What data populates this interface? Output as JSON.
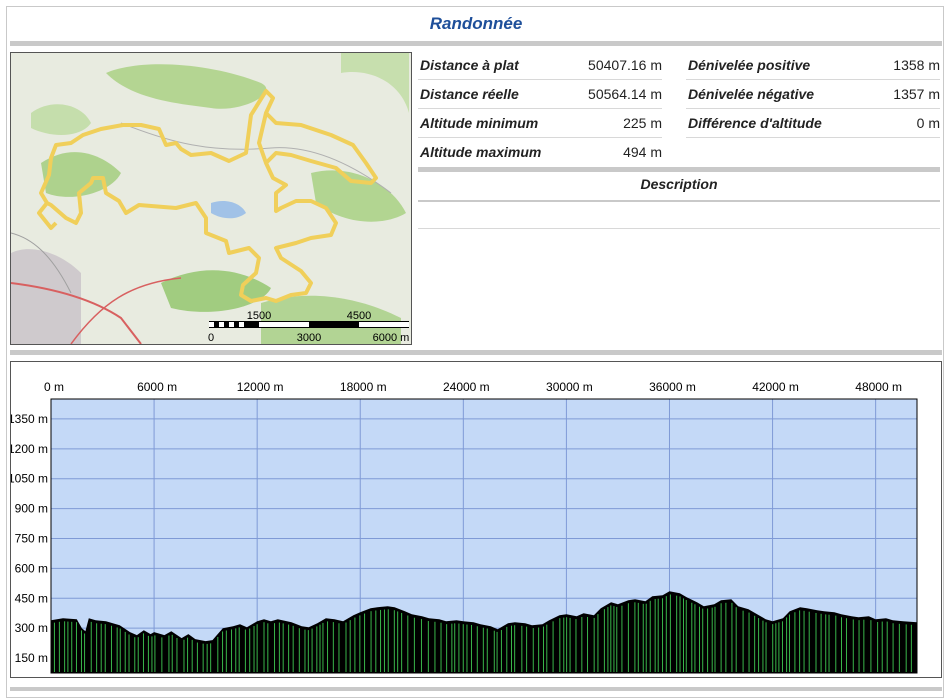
{
  "page": {
    "title": "Randonnée"
  },
  "stats": {
    "distance_plat": {
      "label": "Distance à plat",
      "value": "50407.16 m"
    },
    "distance_reelle": {
      "label": "Distance réelle",
      "value": "50564.14 m"
    },
    "altitude_min": {
      "label": "Altitude minimum",
      "value": "225 m"
    },
    "altitude_max": {
      "label": "Altitude maximum",
      "value": "494 m"
    },
    "denivelee_pos": {
      "label": "Dénivelée positive",
      "value": "1358 m"
    },
    "denivelee_neg": {
      "label": "Dénivelée négative",
      "value": "1357 m"
    },
    "difference": {
      "label": "Différence d'altitude",
      "value": "0 m"
    }
  },
  "description": {
    "label": "Description"
  },
  "map": {
    "scale_labels_top": [
      "1500",
      "4500"
    ],
    "scale_labels_bottom": [
      "0",
      "3000",
      "6000 m"
    ],
    "track_color": "#f0cf5a"
  },
  "colors": {
    "title": "#1e4f9a",
    "chart_bg": "#c4d9f7",
    "grid": "#7f9ad6",
    "profile_fill": "#000000",
    "profile_marks": "#39b54a"
  },
  "chart_data": {
    "type": "area",
    "x_unit": "m",
    "y_unit": "m",
    "xlim": [
      0,
      50407
    ],
    "ylim": [
      75,
      1450
    ],
    "x_ticks": [
      "0 m",
      "6000 m",
      "12000 m",
      "18000 m",
      "24000 m",
      "30000 m",
      "36000 m",
      "42000 m",
      "48000 m"
    ],
    "x_tick_values": [
      0,
      6000,
      12000,
      18000,
      24000,
      30000,
      36000,
      42000,
      48000
    ],
    "y_ticks": [
      "150 m",
      "300 m",
      "450 m",
      "600 m",
      "750 m",
      "900 m",
      "1050 m",
      "1200 m",
      "1350 m"
    ],
    "y_tick_values": [
      150,
      300,
      450,
      600,
      750,
      900,
      1050,
      1200,
      1350
    ],
    "grid": true,
    "series": [
      {
        "x": [
          0,
          700,
          1500,
          1800,
          2000,
          2200,
          2600,
          3200,
          3600,
          4000,
          4600,
          5000,
          5400,
          5800,
          6000,
          6600,
          7000,
          7600,
          8000,
          8400,
          9000,
          9400,
          10000,
          10600,
          11000,
          11400,
          12000,
          12400,
          12800,
          13200,
          14000,
          14600,
          15000,
          15500,
          16000,
          16500,
          17000,
          17600,
          18000,
          18600,
          19000,
          19600,
          20000,
          20600,
          21000,
          21600,
          22000,
          22600,
          23000,
          23600,
          24000,
          24600,
          25000,
          25600,
          26000,
          26600,
          27000,
          27600,
          28000,
          28600,
          29000,
          29600,
          30000,
          30600,
          31000,
          31600,
          32000,
          32600,
          33000,
          33600,
          34000,
          34600,
          35000,
          35600,
          36000,
          36600,
          37000,
          37600,
          38000,
          38600,
          39000,
          39600,
          40000,
          40600,
          41000,
          41600,
          42000,
          42600,
          43000,
          43600,
          44000,
          44600,
          45000,
          45600,
          46000,
          46600,
          47000,
          47600,
          48000,
          48600,
          49000,
          49600,
          50407
        ],
        "y": [
          340,
          350,
          345,
          300,
          285,
          350,
          340,
          335,
          325,
          315,
          280,
          265,
          290,
          270,
          280,
          265,
          285,
          250,
          270,
          245,
          235,
          240,
          300,
          310,
          320,
          305,
          335,
          345,
          335,
          345,
          330,
          310,
          305,
          325,
          350,
          345,
          335,
          365,
          380,
          400,
          405,
          410,
          405,
          385,
          370,
          360,
          350,
          345,
          335,
          340,
          335,
          330,
          320,
          310,
          295,
          325,
          330,
          325,
          315,
          320,
          340,
          365,
          370,
          360,
          375,
          365,
          400,
          430,
          420,
          440,
          445,
          435,
          460,
          465,
          485,
          475,
          455,
          430,
          410,
          420,
          440,
          445,
          410,
          395,
          375,
          345,
          335,
          350,
          385,
          405,
          400,
          390,
          385,
          380,
          370,
          360,
          355,
          360,
          345,
          350,
          340,
          335,
          330
        ]
      }
    ]
  }
}
